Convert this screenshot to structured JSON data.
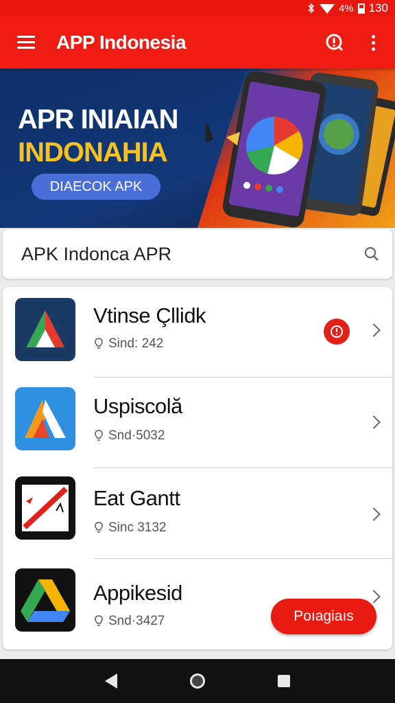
{
  "status_bar": {
    "battery": "4%",
    "time": "130",
    "icons": [
      "bluetooth-icon",
      "wifi-icon",
      "battery-icon"
    ]
  },
  "app_bar": {
    "title": "APP Indonesia",
    "icons": [
      "hamburger-icon",
      "alert-icon",
      "more-vert-icon"
    ]
  },
  "banner": {
    "title_line1": "APR INIAIAN",
    "title_line2": "INDONAHIA",
    "cta": "DIAECOK APK"
  },
  "search": {
    "value": "APK Indonca APR",
    "icon": "search-icon"
  },
  "apps": [
    {
      "name": "Vtinse Çllidk",
      "meta": "Sind: 242",
      "alert": true
    },
    {
      "name": "Uspiscolă",
      "meta": "Snd·5032",
      "alert": false
    },
    {
      "name": "Eat Gantt",
      "meta": "Sinc 3132",
      "alert": false
    },
    {
      "name": "Appikesid",
      "meta": "Snd·3427",
      "alert": false
    }
  ],
  "fab": {
    "label": "Poıagiaıs"
  },
  "colors": {
    "primary": "#ee1c12",
    "banner_blue": "#0d2b5c",
    "banner_yellow": "#f7c21d",
    "cta_blue": "#4a6fd8"
  },
  "nav": {
    "icons": [
      "back-icon",
      "home-icon",
      "recents-icon"
    ]
  }
}
